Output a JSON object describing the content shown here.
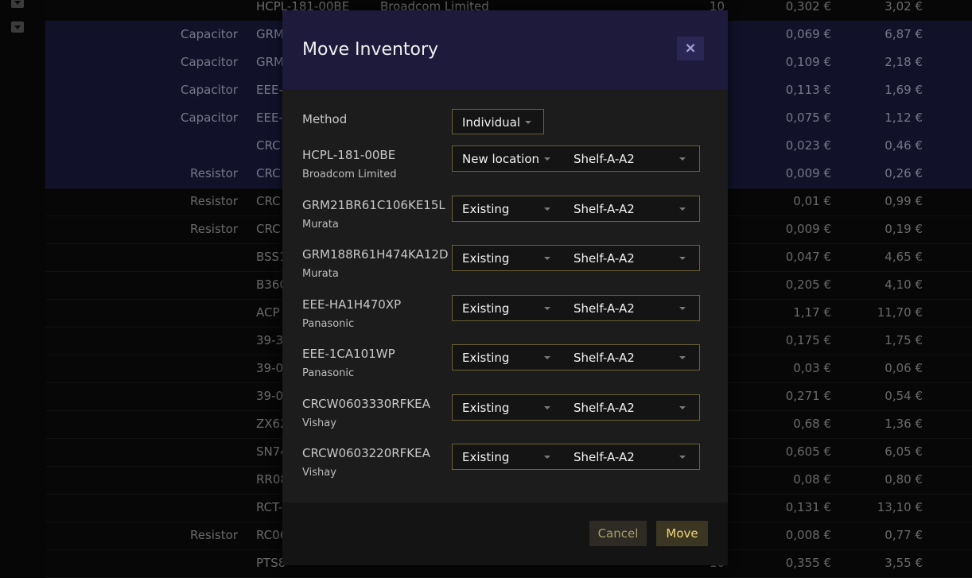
{
  "background_table": {
    "rows": [
      {
        "category": "",
        "part": "HCPL-181-00BE",
        "manufacturer": "Broadcom Limited",
        "qty": "10",
        "unit_price": "0,302 €",
        "total": "3,02 €",
        "selected": false
      },
      {
        "category": "Capacitor",
        "part": "GRM",
        "manufacturer": "",
        "qty": "",
        "unit_price": "0,069 €",
        "total": "6,87 €",
        "selected": true
      },
      {
        "category": "Capacitor",
        "part": "GRM",
        "manufacturer": "",
        "qty": "",
        "unit_price": "0,109 €",
        "total": "2,18 €",
        "selected": true
      },
      {
        "category": "Capacitor",
        "part": "EEE-",
        "manufacturer": "",
        "qty": "",
        "unit_price": "0,113 €",
        "total": "1,69 €",
        "selected": true
      },
      {
        "category": "Capacitor",
        "part": "EEE-",
        "manufacturer": "",
        "qty": "",
        "unit_price": "0,075 €",
        "total": "1,12 €",
        "selected": true
      },
      {
        "category": "",
        "part": "CRC",
        "manufacturer": "",
        "qty": "",
        "unit_price": "0,023 €",
        "total": "0,46 €",
        "selected": true
      },
      {
        "category": "Resistor",
        "part": "CRC",
        "manufacturer": "",
        "qty": "",
        "unit_price": "0,009 €",
        "total": "0,26 €",
        "selected": true
      },
      {
        "category": "Resistor",
        "part": "CRC",
        "manufacturer": "",
        "qty": "",
        "unit_price": "0,01 €",
        "total": "0,99 €",
        "selected": false
      },
      {
        "category": "Resistor",
        "part": "CRC",
        "manufacturer": "",
        "qty": "",
        "unit_price": "0,009 €",
        "total": "0,19 €",
        "selected": false
      },
      {
        "category": "",
        "part": "BSS1",
        "manufacturer": "",
        "qty": "",
        "unit_price": "0,047 €",
        "total": "4,65 €",
        "selected": false
      },
      {
        "category": "",
        "part": "B360",
        "manufacturer": "",
        "qty": "",
        "unit_price": "0,205 €",
        "total": "4,10 €",
        "selected": false
      },
      {
        "category": "",
        "part": "ACP",
        "manufacturer": "",
        "qty": "",
        "unit_price": "1,17 €",
        "total": "11,70 €",
        "selected": false
      },
      {
        "category": "",
        "part": "39-3",
        "manufacturer": "",
        "qty": "",
        "unit_price": "0,175 €",
        "total": "1,75 €",
        "selected": false
      },
      {
        "category": "",
        "part": "39-0",
        "manufacturer": "",
        "qty": "",
        "unit_price": "0,03 €",
        "total": "0,06 €",
        "selected": false
      },
      {
        "category": "",
        "part": "39-0",
        "manufacturer": "",
        "qty": "",
        "unit_price": "0,271 €",
        "total": "0,54 €",
        "selected": false
      },
      {
        "category": "",
        "part": "ZX62",
        "manufacturer": "",
        "qty": "",
        "unit_price": "0,68 €",
        "total": "1,36 €",
        "selected": false
      },
      {
        "category": "",
        "part": "SN74",
        "manufacturer": "",
        "qty": "",
        "unit_price": "0,605 €",
        "total": "6,05 €",
        "selected": false
      },
      {
        "category": "",
        "part": "RR08",
        "manufacturer": "",
        "qty": "",
        "unit_price": "0,08 €",
        "total": "0,80 €",
        "selected": false
      },
      {
        "category": "",
        "part": "RCT-",
        "manufacturer": "",
        "qty": "",
        "unit_price": "0,131 €",
        "total": "13,10 €",
        "selected": false
      },
      {
        "category": "Resistor",
        "part": "RC06",
        "manufacturer": "",
        "qty": "",
        "unit_price": "0,008 €",
        "total": "0,77 €",
        "selected": false
      },
      {
        "category": "",
        "part": "PTS8",
        "manufacturer": "",
        "qty": "10",
        "unit_price": "0,355 €",
        "total": "3,55 €",
        "selected": false
      }
    ]
  },
  "modal": {
    "title": "Move Inventory",
    "close_label": "×",
    "method_label": "Method",
    "method_value": "Individual",
    "items": [
      {
        "part": "HCPL-181-00BE",
        "manufacturer": "Broadcom Limited",
        "mode": "New location",
        "location": "Shelf-A-A2"
      },
      {
        "part": "GRM21BR61C106KE15L",
        "manufacturer": "Murata",
        "mode": "Existing",
        "location": "Shelf-A-A2"
      },
      {
        "part": "GRM188R61H474KA12D",
        "manufacturer": "Murata",
        "mode": "Existing",
        "location": "Shelf-A-A2"
      },
      {
        "part": "EEE-HA1H470XP",
        "manufacturer": "Panasonic",
        "mode": "Existing",
        "location": "Shelf-A-A2"
      },
      {
        "part": "EEE-1CA101WP",
        "manufacturer": "Panasonic",
        "mode": "Existing",
        "location": "Shelf-A-A2"
      },
      {
        "part": "CRCW0603330RFKEA",
        "manufacturer": "Vishay",
        "mode": "Existing",
        "location": "Shelf-A-A2"
      },
      {
        "part": "CRCW0603220RFKEA",
        "manufacturer": "Vishay",
        "mode": "Existing",
        "location": "Shelf-A-A2"
      }
    ],
    "cancel_label": "Cancel",
    "move_label": "Move"
  },
  "colors": {
    "header_bg": "#1e1a3b",
    "select_border": "#6a6236",
    "move_text": "#f0d57a"
  }
}
